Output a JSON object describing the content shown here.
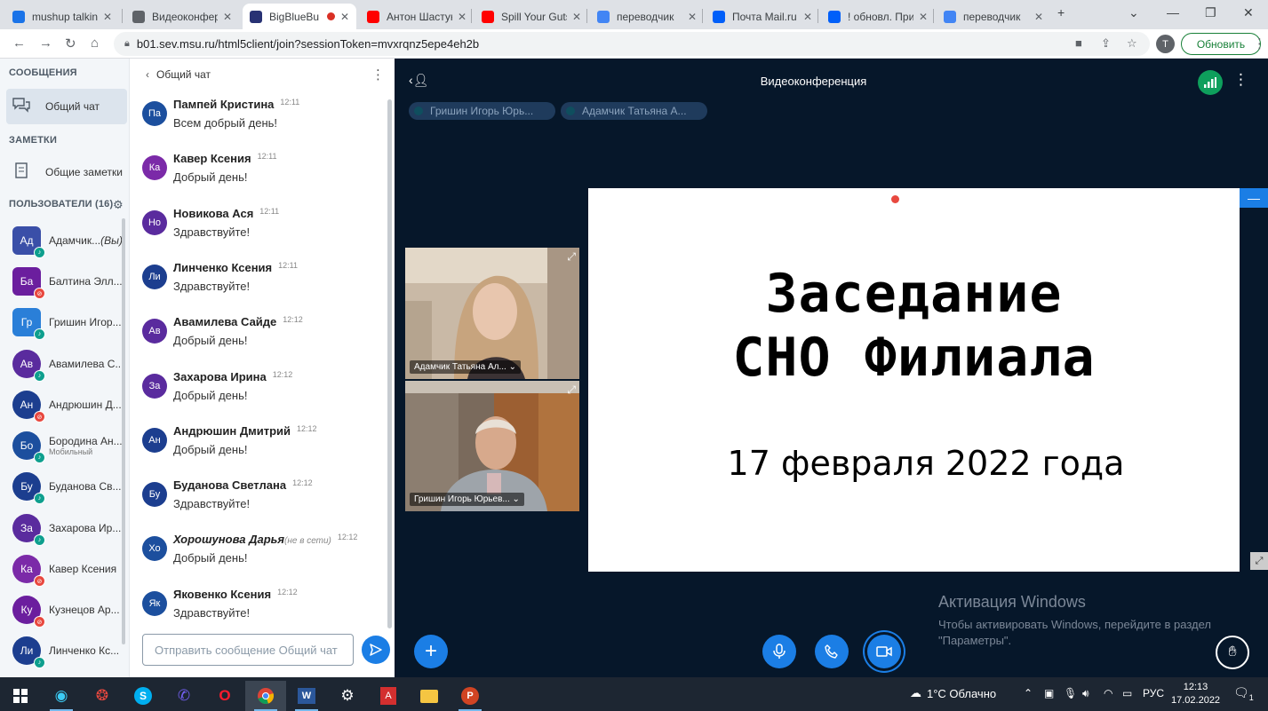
{
  "browser": {
    "tabs": [
      {
        "label": "mushup talkin",
        "favicon": "chat-favicon",
        "color": "#1a73e8"
      },
      {
        "label": "Видеоконфер",
        "favicon": "globe-favicon",
        "color": "#5f6368"
      },
      {
        "label": "BigBlueBu",
        "favicon": "bigbluebutton-favicon",
        "color": "#283274"
      },
      {
        "label": "Антон Шастун",
        "favicon": "youtube-favicon",
        "color": "#ff0000"
      },
      {
        "label": "Spill Your Guts",
        "favicon": "youtube-favicon",
        "color": "#ff0000"
      },
      {
        "label": "переводчик",
        "favicon": "google-favicon",
        "color": "#4285f4"
      },
      {
        "label": "Почта Mail.ru",
        "favicon": "mail-favicon",
        "color": "#005ff9"
      },
      {
        "label": "! обновл. При",
        "favicon": "mail-favicon",
        "color": "#005ff9"
      },
      {
        "label": "переводчик",
        "favicon": "google-favicon",
        "color": "#4285f4"
      }
    ],
    "url": "b01.sev.msu.ru/html5client/join?sessionToken=mvxrqnz5epe4eh2b",
    "profile_initial": "T",
    "update_label": "Обновить"
  },
  "sidebar": {
    "messages_heading": "СООБЩЕНИЯ",
    "public_chat": "Общий чат",
    "notes_heading": "ЗАМЕТКИ",
    "shared_notes": "Общие заметки",
    "users_heading": "ПОЛЬЗОВАТЕЛИ (16)",
    "users": [
      {
        "initials": "Ад",
        "name": "Адамчик...",
        "suffix": "(Вы)",
        "color": "#3a4fa8",
        "status": "#0e9f8e",
        "square": true
      },
      {
        "initials": "Ба",
        "name": "Балтина Элл...",
        "suffix": "",
        "color": "#6b1e9e",
        "status": "#e8483f",
        "square": true
      },
      {
        "initials": "Гр",
        "name": "Гришин Игор...",
        "suffix": "",
        "color": "#2a7fd8",
        "status": "#0e9f8e",
        "square": true
      },
      {
        "initials": "Ав",
        "name": "Авамилева С...",
        "suffix": "",
        "color": "#5a2b9e",
        "status": "#0e9f8e",
        "square": false
      },
      {
        "initials": "Ан",
        "name": "Андрюшин Д...",
        "suffix": "",
        "color": "#1c3e8f",
        "status": "#e8483f",
        "square": false
      },
      {
        "initials": "Бо",
        "name": "Бородина Ан...",
        "sub": "Мобильный",
        "suffix": "",
        "color": "#1c4f9e",
        "status": "#0e9f8e",
        "square": false
      },
      {
        "initials": "Бу",
        "name": "Буданова Св...",
        "suffix": "",
        "color": "#1c3e8f",
        "status": "#0e9f8e",
        "square": false
      },
      {
        "initials": "За",
        "name": "Захарова Ир...",
        "suffix": "",
        "color": "#5a2b9e",
        "status": "#0e9f8e",
        "square": false
      },
      {
        "initials": "Ка",
        "name": "Кавер Ксения",
        "suffix": "",
        "color": "#7b2aa8",
        "status": "#e8483f",
        "square": false
      },
      {
        "initials": "Ку",
        "name": "Кузнецов Ар...",
        "suffix": "",
        "color": "#6b1e9e",
        "status": "#e8483f",
        "square": false
      },
      {
        "initials": "Ли",
        "name": "Линченко Кс...",
        "suffix": "",
        "color": "#1c3e8f",
        "status": "#0e9f8e",
        "square": false
      }
    ]
  },
  "chat": {
    "title": "Общий чат",
    "messages": [
      {
        "initials": "Па",
        "name": "Пампей Кристина",
        "time": "12:11",
        "text": "Всем добрый день!",
        "color": "#1c4f9e",
        "offline": ""
      },
      {
        "initials": "Ка",
        "name": "Кавер Ксения",
        "time": "12:11",
        "text": "Добрый день!",
        "color": "#7b2aa8",
        "offline": ""
      },
      {
        "initials": "Но",
        "name": "Новикова Ася",
        "time": "12:11",
        "text": "Здравствуйте!",
        "color": "#5a2b9e",
        "offline": ""
      },
      {
        "initials": "Ли",
        "name": "Линченко Ксения",
        "time": "12:11",
        "text": "Здравствуйте!",
        "color": "#1c3e8f",
        "offline": ""
      },
      {
        "initials": "Ав",
        "name": "Авамилева Сайде",
        "time": "12:12",
        "text": "Добрый день!",
        "color": "#5a2b9e",
        "offline": ""
      },
      {
        "initials": "За",
        "name": "Захарова Ирина",
        "time": "12:12",
        "text": "Добрый день!",
        "color": "#5a2b9e",
        "offline": ""
      },
      {
        "initials": "Ан",
        "name": "Андрюшин Дмитрий",
        "time": "12:12",
        "text": "Добрый день!",
        "color": "#1c3e8f",
        "offline": ""
      },
      {
        "initials": "Бу",
        "name": "Буданова Светлана",
        "time": "12:12",
        "text": "Здравствуйте!",
        "color": "#1c3e8f",
        "offline": ""
      },
      {
        "initials": "Хо",
        "name": "Хорошунова Дарья",
        "time": "12:12",
        "text": "Добрый день!",
        "color": "#1c4f9e",
        "offline": "(не в сети)"
      },
      {
        "initials": "Як",
        "name": "Яковенко Ксения",
        "time": "12:12",
        "text": "Здравствуйте!",
        "color": "#1c4f9e",
        "offline": ""
      }
    ],
    "input_placeholder": "Отправить сообщение Общий чат"
  },
  "conference": {
    "title": "Видеоконференция",
    "talkers": [
      "Гришин Игорь Юрь...",
      "Адамчик Татьяна А..."
    ],
    "videos": [
      {
        "label": "Адамчик Татьяна Ал..."
      },
      {
        "label": "Гришин Игорь Юрьев..."
      }
    ],
    "slide": {
      "title_line1": "Заседание",
      "title_line2": "СНО Филиала",
      "date": "17 февраля 2022 года"
    },
    "watermark": {
      "title": "Активация Windows",
      "line1": "Чтобы активировать Windows, перейдите в раздел",
      "line2": "\"Параметры\"."
    }
  },
  "taskbar": {
    "weather": "1°C  Облачно",
    "language": "РУС",
    "time": "12:13",
    "date": "17.02.2022",
    "notification_count": "1"
  }
}
